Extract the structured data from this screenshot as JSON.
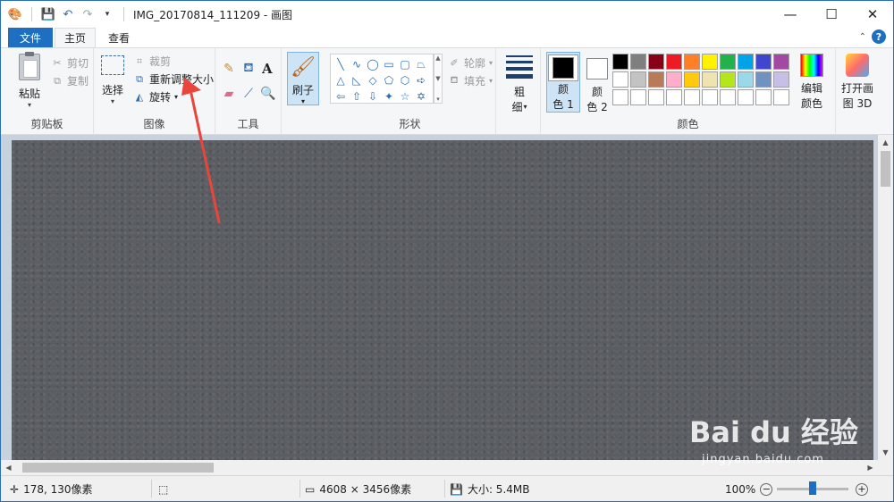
{
  "window": {
    "title": "IMG_20170814_111209 - 画图",
    "controls": {
      "minimize": "—",
      "maximize": "☐",
      "close": "✕"
    }
  },
  "quick_access": {
    "icons": [
      "paint-app-icon",
      "save-icon",
      "undo-icon",
      "redo-icon",
      "customize-dropdown-icon"
    ]
  },
  "tabs": {
    "file": "文件",
    "home": "主页",
    "view": "查看",
    "help": "?"
  },
  "clipboard": {
    "paste": "粘贴",
    "cut": "剪切",
    "copy": "复制",
    "label": "剪贴板"
  },
  "image": {
    "select": "选择",
    "crop": "裁剪",
    "resize": "重新调整大小",
    "rotate": "旋转",
    "label": "图像"
  },
  "tools": {
    "label": "工具",
    "text_tool": "A"
  },
  "brushes": {
    "label": "刷子"
  },
  "shapes": {
    "outline": "轮廓",
    "fill": "填充",
    "label": "形状",
    "glyphs": [
      "╲",
      "∿",
      "◯",
      "▭",
      "▢",
      "⏢",
      "△",
      "◺",
      "◇",
      "⬠",
      "⬡",
      "➪",
      "⇦",
      "⇧",
      "⇩",
      "✦",
      "☆",
      "✡"
    ]
  },
  "size": {
    "label_line1": "粗",
    "label_line2": "细"
  },
  "colors": {
    "color1_line1": "颜",
    "color1_line2": "色 1",
    "color2_line1": "颜",
    "color2_line2": "色 2",
    "edit_line1": "编辑",
    "edit_line2": "颜色",
    "label": "颜色",
    "color1_value": "#000000",
    "color2_value": "#ffffff",
    "palette": [
      "#000000",
      "#7f7f7f",
      "#880015",
      "#ed1c24",
      "#ff7f27",
      "#fff200",
      "#22b14c",
      "#00a2e8",
      "#3f48cc",
      "#a349a4",
      "#ffffff",
      "#c3c3c3",
      "#b97a57",
      "#ffaec9",
      "#ffc90e",
      "#efe4b0",
      "#b5e61d",
      "#99d9ea",
      "#7092be",
      "#c8bfe7",
      "#ffffff",
      "#ffffff",
      "#ffffff",
      "#ffffff",
      "#ffffff",
      "#ffffff",
      "#ffffff",
      "#ffffff",
      "#ffffff",
      "#ffffff"
    ]
  },
  "paint3d": {
    "line1": "打开画",
    "line2": "图 3D"
  },
  "status": {
    "cursor": "178, 130像素",
    "dimensions": "4608 × 3456像素",
    "size": "大小: 5.4MB",
    "zoom": "100%",
    "zoom_level": 0.5
  },
  "watermark": {
    "logo": "Bai du 经验",
    "url": "jingyan.baidu.com"
  }
}
